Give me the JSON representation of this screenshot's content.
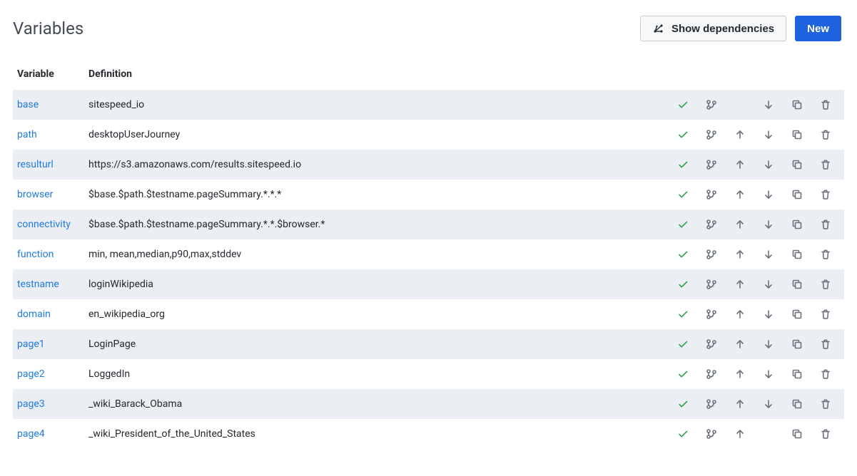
{
  "header": {
    "title": "Variables",
    "show_dependencies_label": "Show dependencies",
    "new_label": "New"
  },
  "columns": {
    "variable": "Variable",
    "definition": "Definition"
  },
  "rows": [
    {
      "name": "base",
      "definition": "sitespeed_io",
      "has_up": false,
      "has_down": true
    },
    {
      "name": "path",
      "definition": "desktopUserJourney",
      "has_up": true,
      "has_down": true
    },
    {
      "name": "resulturl",
      "definition": "https://s3.amazonaws.com/results.sitespeed.io",
      "has_up": true,
      "has_down": true
    },
    {
      "name": "browser",
      "definition": "$base.$path.$testname.pageSummary.*.*.*",
      "has_up": true,
      "has_down": true
    },
    {
      "name": "connectivity",
      "definition": "$base.$path.$testname.pageSummary.*.*.$browser.*",
      "has_up": true,
      "has_down": true
    },
    {
      "name": "function",
      "definition": "min, mean,median,p90,max,stddev",
      "has_up": true,
      "has_down": true
    },
    {
      "name": "testname",
      "definition": "loginWikipedia",
      "has_up": true,
      "has_down": true
    },
    {
      "name": "domain",
      "definition": "en_wikipedia_org",
      "has_up": true,
      "has_down": true
    },
    {
      "name": "page1",
      "definition": "LoginPage",
      "has_up": true,
      "has_down": true
    },
    {
      "name": "page2",
      "definition": "LoggedIn",
      "has_up": true,
      "has_down": true
    },
    {
      "name": "page3",
      "definition": "_wiki_Barack_Obama",
      "has_up": true,
      "has_down": true
    },
    {
      "name": "page4",
      "definition": "_wiki_President_of_the_United_States",
      "has_up": true,
      "has_down": false
    }
  ]
}
